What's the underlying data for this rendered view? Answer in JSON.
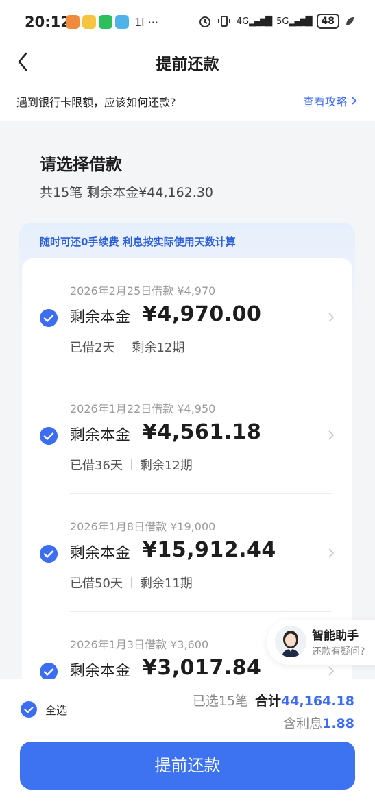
{
  "status_bar": {
    "time": "20:12",
    "extra": "1l ···",
    "network_left": "4G",
    "network_right": "5G",
    "battery": "48"
  },
  "header": {
    "title": "提前还款"
  },
  "notice": {
    "question": "遇到银行卡限额，应该如何还款?",
    "guide_link": "查看攻略"
  },
  "section": {
    "title": "请选择借款",
    "summary": "共15笔 剩余本金¥44,162.30"
  },
  "banner": "随时可还0手续费 利息按实际使用天数计算",
  "loans": [
    {
      "date_line": "2026年2月25日借款 ¥4,970",
      "label": "剩余本金",
      "amount": "¥4,970.00",
      "borrowed": "已借2天",
      "remaining": "剩余12期",
      "checked": true
    },
    {
      "date_line": "2026年1月22日借款 ¥4,950",
      "label": "剩余本金",
      "amount": "¥4,561.18",
      "borrowed": "已借36天",
      "remaining": "剩余12期",
      "checked": true
    },
    {
      "date_line": "2026年1月8日借款 ¥19,000",
      "label": "剩余本金",
      "amount": "¥15,912.44",
      "borrowed": "已借50天",
      "remaining": "剩余11期",
      "checked": true
    },
    {
      "date_line": "2026年1月3日借款 ¥3,600",
      "label": "剩余本金",
      "amount": "¥3,017.84",
      "borrowed": "",
      "remaining": "",
      "checked": true
    }
  ],
  "assistant": {
    "name": "智能助手",
    "hint": "还款有疑问?"
  },
  "bottom": {
    "select_all": "全选",
    "selected_count": "已选15笔",
    "total_label": "合计",
    "total": "44,164.18",
    "interest_label": "含利息",
    "interest": "1.88",
    "submit": "提前还款"
  },
  "colors": {
    "accent": "#3d6df0",
    "button": "#3d72f0"
  }
}
